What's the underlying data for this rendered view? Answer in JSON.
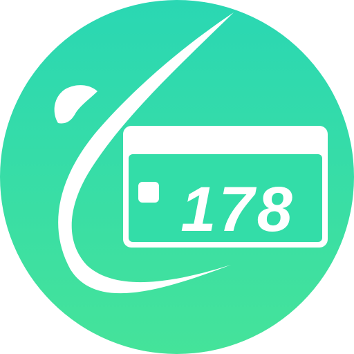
{
  "logo": {
    "name": "178 card logo",
    "card_number": "178",
    "colors": {
      "gradient_top": "#2AD7B3",
      "gradient_bottom": "#45E39A",
      "foreground": "#FFFFFF"
    }
  }
}
